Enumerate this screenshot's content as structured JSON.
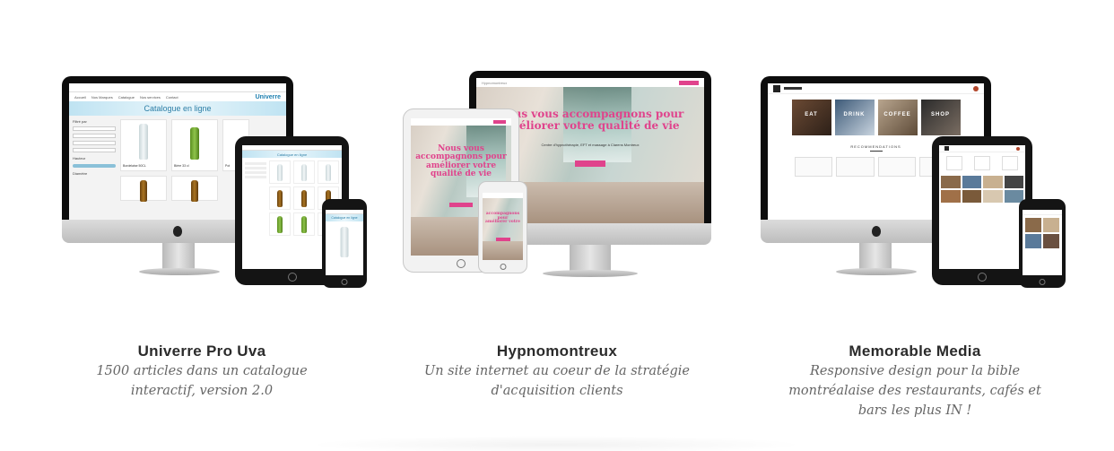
{
  "projects": [
    {
      "title": "Univerre Pro Uva",
      "description_line1": "1500 articles dans un catalogue",
      "description_line2": "interactif, version 2.0",
      "screen": {
        "logo": "Univerre",
        "banner": "Catalogue en ligne",
        "tablet_banner": "Catalogue en ligne",
        "phone_banner": "Catalogue en ligne",
        "filter_label": "Filtré par",
        "height_label": "Hauteur",
        "diameter_label": "Diamètre",
        "products": [
          "Bordelaise 50CL",
          "Bière 33 cl",
          "Pot"
        ]
      }
    },
    {
      "title": "Hypnomontreux",
      "description_line1": "Un site internet au coeur de la stratégie",
      "description_line2": "d'acquisition clients",
      "screen": {
        "brand": "Hypnomontreux",
        "headline_line1": "Nous vous accompagnons pour",
        "headline_line2": "améliorer votre qualité de vie",
        "tablet_headline_line1": "Nous vous",
        "tablet_headline_line2": "accompagnons pour",
        "tablet_headline_line3": "améliorer votre",
        "tablet_headline_line4": "qualité de vie",
        "subline": "Centre d'hypnothérapie, EFT et massage à Clarens Montreux",
        "accent_color": "#e0438c"
      }
    },
    {
      "title": "Memorable Media",
      "description_line1": "Responsive design pour la bible",
      "description_line2": "montréalaise des restaurants, cafés et",
      "description_line3": "bars les plus IN !",
      "screen": {
        "tiles": [
          "EAT",
          "DRINK",
          "COFFEE",
          "SHOP"
        ],
        "recommendations_label": "RECOMMENDATIONS"
      }
    }
  ],
  "icons": [
    "apple-logo-icon",
    "home-button-icon"
  ]
}
